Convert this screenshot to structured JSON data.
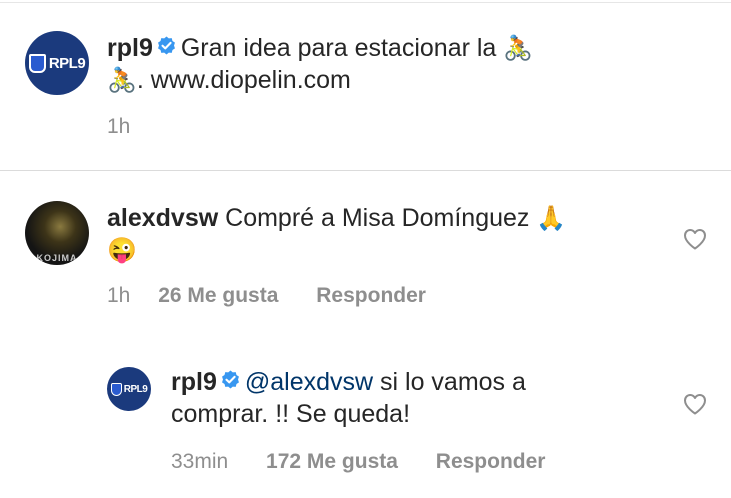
{
  "caption": {
    "username": "rpl9",
    "avatar_text": "RPL9",
    "text_line1": "Gran idea para estacionar la",
    "text_line2": ". www.diopelin.com",
    "emoji": "🚴",
    "time": "1h"
  },
  "comment": {
    "username": "alexdvsw",
    "avatar_caption": "KOJIMA",
    "text_line1": "Compré a Misa Domínguez",
    "emoji_pray": "🙏",
    "emoji_face": "😜",
    "time": "1h",
    "likes": "26 Me gusta",
    "reply_label": "Responder"
  },
  "reply": {
    "username": "rpl9",
    "avatar_text": "RPL9",
    "mention": "@alexdvsw",
    "text_line1": " si lo vamos a",
    "text_line2": "comprar. !! Se queda!",
    "time": "33min",
    "likes": "172 Me gusta",
    "reply_label": "Responder"
  },
  "colors": {
    "verified_badge": "#3897f0",
    "meta_gray": "#8e8e8e",
    "avatar_blue": "#1b3a7d"
  }
}
